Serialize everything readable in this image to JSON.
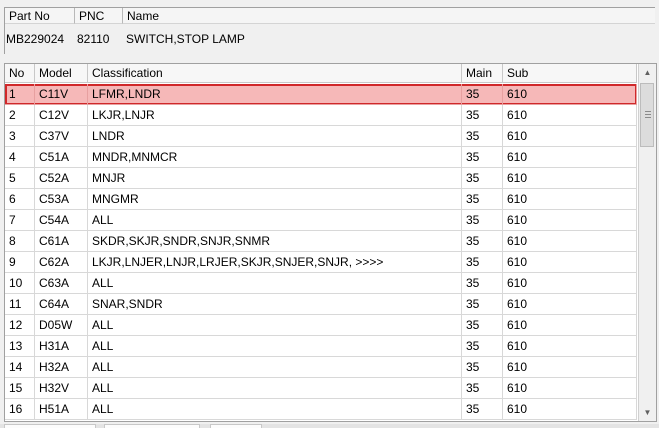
{
  "part_info": {
    "headers": [
      "Part No",
      "PNC",
      "Name"
    ],
    "part_no": "MB229024",
    "pnc": "82110",
    "name": "SWITCH,STOP LAMP"
  },
  "table": {
    "columns": [
      "No",
      "Model",
      "Classification",
      "Main",
      "Sub"
    ],
    "rows": [
      [
        "1",
        "C11V",
        "LFMR,LNDR",
        "35",
        "610"
      ],
      [
        "2",
        "C12V",
        "LKJR,LNJR",
        "35",
        "610"
      ],
      [
        "3",
        "C37V",
        "LNDR",
        "35",
        "610"
      ],
      [
        "4",
        "C51A",
        "MNDR,MNMCR",
        "35",
        "610"
      ],
      [
        "5",
        "C52A",
        "MNJR",
        "35",
        "610"
      ],
      [
        "6",
        "C53A",
        "MNGMR",
        "35",
        "610"
      ],
      [
        "7",
        "C54A",
        "ALL",
        "35",
        "610"
      ],
      [
        "8",
        "C61A",
        "SKDR,SKJR,SNDR,SNJR,SNMR",
        "35",
        "610"
      ],
      [
        "9",
        "C62A",
        "LKJR,LNJER,LNJR,LRJER,SKJR,SNJER,SNJR,   >>>>",
        "35",
        "610"
      ],
      [
        "10",
        "C63A",
        "ALL",
        "35",
        "610"
      ],
      [
        "11",
        "C64A",
        "SNAR,SNDR",
        "35",
        "610"
      ],
      [
        "12",
        "D05W",
        "ALL",
        "35",
        "610"
      ],
      [
        "13",
        "H31A",
        "ALL",
        "35",
        "610"
      ],
      [
        "14",
        "H32A",
        "ALL",
        "35",
        "610"
      ],
      [
        "15",
        "H32V",
        "ALL",
        "35",
        "610"
      ],
      [
        "16",
        "H51A",
        "ALL",
        "35",
        "610"
      ]
    ],
    "selected_index": 0
  },
  "scrollbar": {
    "up_icon": "triangle-up-icon",
    "down_icon": "triangle-down-icon",
    "up_glyph": "▲",
    "down_glyph": "▼"
  },
  "colors": {
    "selection_fill": "#f6b8b8",
    "selection_border": "#d0282a"
  }
}
